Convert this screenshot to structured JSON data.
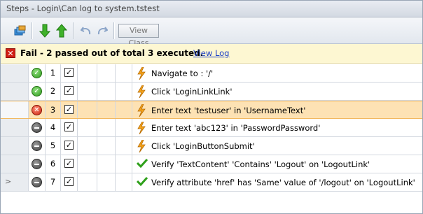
{
  "window": {
    "title": "Steps - Login\\Can log to system.tstest"
  },
  "toolbar": {
    "view_class_label": "View Class",
    "icons": [
      "stack-icon",
      "move-down-icon",
      "move-up-icon",
      "undo-icon",
      "redo-icon"
    ]
  },
  "status": {
    "result": "Fail",
    "text": "Fail - 2 passed out of total 3 executed.",
    "link": "View Log",
    "colors": {
      "fail": "#d11f14",
      "banner": "#fdf7d2",
      "link": "#1a3ec7"
    }
  },
  "steps": [
    {
      "num": "1",
      "status": "pass",
      "checked": true,
      "icon": "lightning-icon",
      "text": "Navigate to : '/'"
    },
    {
      "num": "2",
      "status": "pass",
      "checked": true,
      "icon": "lightning-icon",
      "text": "Click 'LoginLinkLink'"
    },
    {
      "num": "3",
      "status": "fail",
      "checked": true,
      "icon": "lightning-icon",
      "text": "Enter text 'testuser' in 'UsernameText'",
      "selected": true
    },
    {
      "num": "4",
      "status": "skip",
      "checked": true,
      "icon": "lightning-icon",
      "text": "Enter text 'abc123' in 'PasswordPassword'"
    },
    {
      "num": "5",
      "status": "skip",
      "checked": true,
      "icon": "lightning-icon",
      "text": "Click 'LoginButtonSubmit'"
    },
    {
      "num": "6",
      "status": "skip",
      "checked": true,
      "icon": "checkmark-icon",
      "text": "Verify 'TextContent' 'Contains' 'Logout' on 'LogoutLink'"
    },
    {
      "num": "7",
      "status": "skip",
      "checked": true,
      "icon": "checkmark-icon",
      "text": "Verify attribute 'href' has 'Same' value of '/logout' on 'LogoutLink'",
      "current": true
    }
  ]
}
